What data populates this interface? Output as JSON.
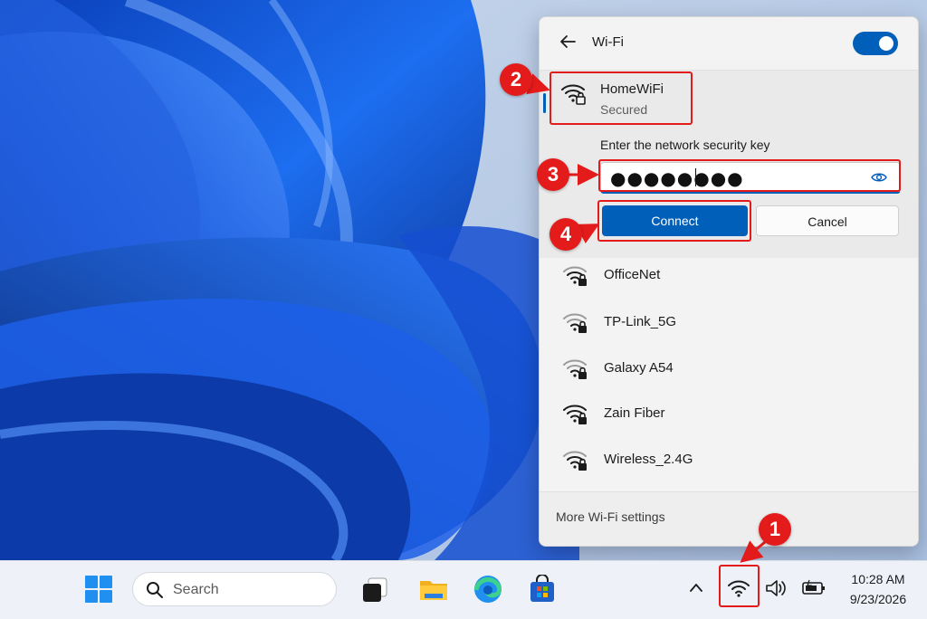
{
  "wifi_panel": {
    "title": "Wi-Fi",
    "toggle_state": "on",
    "selected_network": {
      "name": "HomeWiFi",
      "status": "Secured",
      "key_label": "Enter the network security key",
      "password_masked": "●●●●●●●●",
      "connect_label": "Connect",
      "cancel_label": "Cancel"
    },
    "networks": [
      {
        "name": "OfficeNet"
      },
      {
        "name": "TP-Link_5G"
      },
      {
        "name": "Galaxy A54"
      },
      {
        "name": "Zain Fiber"
      },
      {
        "name": "Wireless_2.4G"
      }
    ],
    "footer_link": "More Wi-Fi settings"
  },
  "taskbar": {
    "search_placeholder": "Search",
    "time": "10:28 AM",
    "date": "9/23/2026",
    "icons": [
      "windows-start-icon",
      "search-icon",
      "task-view-icon",
      "file-explorer-icon",
      "edge-icon",
      "store-icon",
      "chevron-up-icon",
      "wifi-icon",
      "speaker-icon",
      "battery-icon"
    ]
  },
  "annotations": [
    "1",
    "2",
    "3",
    "4"
  ],
  "colors": {
    "accent": "#005fb8",
    "annotation_red": "#e31b1b",
    "wallpaper_blue": "#1a4fd6"
  }
}
